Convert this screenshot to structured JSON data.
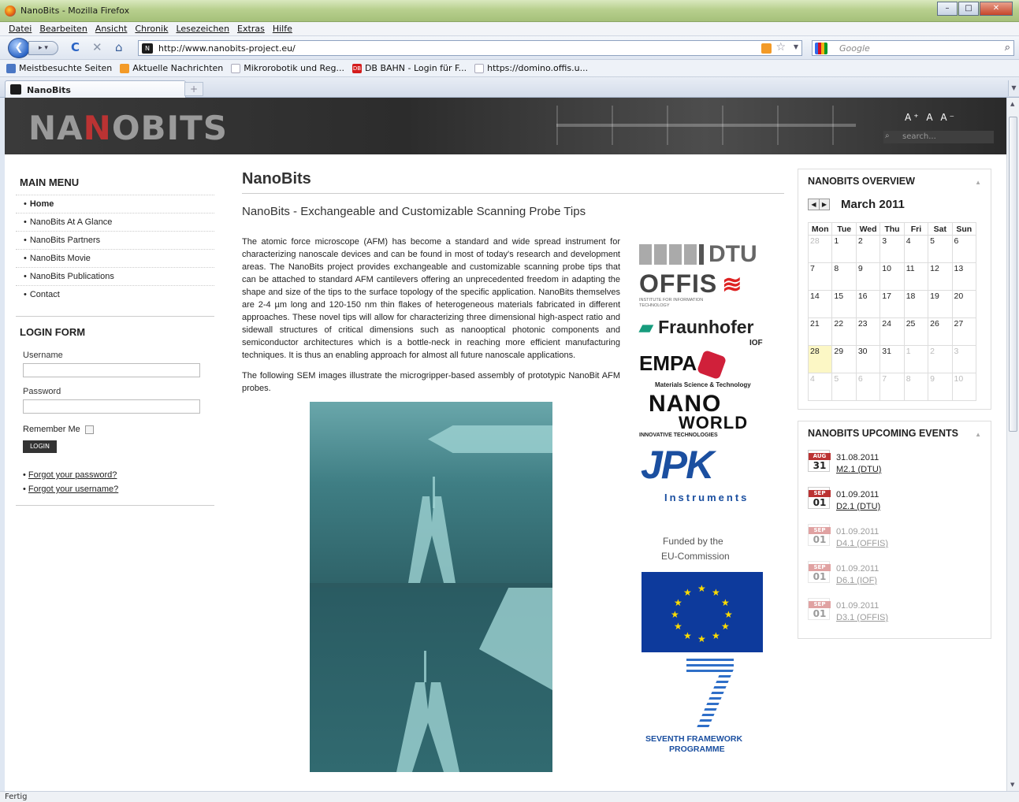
{
  "window": {
    "title": "NanoBits - Mozilla Firefox"
  },
  "menubar": [
    "Datei",
    "Bearbeiten",
    "Ansicht",
    "Chronik",
    "Lesezeichen",
    "Extras",
    "Hilfe"
  ],
  "nav": {
    "url": "http://www.nanobits-project.eu/",
    "search_placeholder": "Google"
  },
  "bookmarks": [
    {
      "label": "Meistbesuchte Seiten"
    },
    {
      "label": "Aktuelle Nachrichten"
    },
    {
      "label": "Mikrorobotik und Reg..."
    },
    {
      "label": "DB BAHN - Login für F..."
    },
    {
      "label": "https://domino.offis.u..."
    }
  ],
  "tab": {
    "label": "NanoBits",
    "new_tab": "+"
  },
  "header": {
    "logo_left": "NA",
    "logo_n": "N",
    "logo_right": "OBITS",
    "font_sizes": "A⁺ A A⁻",
    "search_placeholder": "search..."
  },
  "sidebar": {
    "main_menu_title": "MAIN MENU",
    "items": [
      {
        "label": "Home"
      },
      {
        "label": "NanoBits At A Glance"
      },
      {
        "label": "NanoBits Partners"
      },
      {
        "label": "NanoBits Movie"
      },
      {
        "label": "NanoBits Publications"
      },
      {
        "label": "Contact"
      }
    ],
    "login_title": "LOGIN FORM",
    "username_label": "Username",
    "password_label": "Password",
    "remember_label": "Remember Me",
    "login_button": "LOGIN",
    "forgot_password": "Forgot your password?",
    "forgot_username": "Forgot your username?"
  },
  "main": {
    "title": "NanoBits",
    "subtitle": "NanoBits - Exchangeable and Customizable Scanning Probe Tips",
    "paragraph1": "The atomic force microscope (AFM) has become a standard and wide spread instrument for characterizing nanoscale devices and can be found in most of today's research and development areas. The NanoBits project provides exchangeable and customizable scanning probe tips that can be attached to standard AFM cantilevers offering an unprecedented freedom in adapting the shape and size of the tips to the surface topology of the specific application. NanoBits themselves are 2-4 µm long and 120-150 nm thin flakes of heterogeneous materials fabricated in different approaches. These novel tips will allow for characterizing three dimensional high-aspect ratio and sidewall structures of critical dimensions such as nanooptical photonic components and semiconductor architectures which is a bottle-neck in reaching more efficient manufacturing techniques. It is thus an enabling approach for almost all future nanoscale applications.",
    "paragraph2": "The following SEM images illustrate the microgripper-based assembly of prototypic NanoBit AFM probes."
  },
  "partners": {
    "dtu": "DTU",
    "offis": "OFFIS",
    "offis_sub": "INSTITUTE FOR INFORMATION TECHNOLOGY",
    "fraunhofer": "Fraunhofer",
    "fraunhofer_sub": "IOF",
    "empa": "EMPA",
    "empa_sub": "Materials Science & Technology",
    "nano": "NANO",
    "world": "WORLD",
    "nanoworld_sub": "INNOVATIVE TECHNOLOGIES",
    "jpk": "JPK",
    "jpk_sub": "Instruments",
    "funded": "Funded by the",
    "funded2": "EU-Commission",
    "fp7": "SEVENTH FRAMEWORK",
    "fp7b": "PROGRAMME"
  },
  "overview": {
    "title": "NANOBITS OVERVIEW",
    "month": "March 2011",
    "days": [
      "Mon",
      "Tue",
      "Wed",
      "Thu",
      "Fri",
      "Sat",
      "Sun"
    ],
    "weeks": [
      [
        {
          "d": "28",
          "o": true
        },
        {
          "d": "1"
        },
        {
          "d": "2"
        },
        {
          "d": "3"
        },
        {
          "d": "4"
        },
        {
          "d": "5"
        },
        {
          "d": "6"
        }
      ],
      [
        {
          "d": "7"
        },
        {
          "d": "8"
        },
        {
          "d": "9"
        },
        {
          "d": "10"
        },
        {
          "d": "11"
        },
        {
          "d": "12"
        },
        {
          "d": "13"
        }
      ],
      [
        {
          "d": "14"
        },
        {
          "d": "15"
        },
        {
          "d": "16"
        },
        {
          "d": "17"
        },
        {
          "d": "18"
        },
        {
          "d": "19"
        },
        {
          "d": "20"
        }
      ],
      [
        {
          "d": "21"
        },
        {
          "d": "22"
        },
        {
          "d": "23"
        },
        {
          "d": "24"
        },
        {
          "d": "25"
        },
        {
          "d": "26"
        },
        {
          "d": "27"
        }
      ],
      [
        {
          "d": "28",
          "t": true
        },
        {
          "d": "29"
        },
        {
          "d": "30"
        },
        {
          "d": "31"
        },
        {
          "d": "1",
          "o": true
        },
        {
          "d": "2",
          "o": true
        },
        {
          "d": "3",
          "o": true
        }
      ],
      [
        {
          "d": "4",
          "o": true
        },
        {
          "d": "5",
          "o": true
        },
        {
          "d": "6",
          "o": true
        },
        {
          "d": "7",
          "o": true
        },
        {
          "d": "8",
          "o": true
        },
        {
          "d": "9",
          "o": true
        },
        {
          "d": "10",
          "o": true
        }
      ]
    ]
  },
  "events": {
    "title": "NANOBITS UPCOMING EVENTS",
    "items": [
      {
        "mo": "AUG",
        "dy": "31",
        "date": "31.08.2011",
        "name": "M2.1 (DTU)"
      },
      {
        "mo": "SEP",
        "dy": "01",
        "date": "01.09.2011",
        "name": "D2.1 (DTU)"
      },
      {
        "mo": "SEP",
        "dy": "01",
        "date": "01.09.2011",
        "name": "D4.1 (OFFIS)"
      },
      {
        "mo": "SEP",
        "dy": "01",
        "date": "01.09.2011",
        "name": "D6.1 (IOF)"
      },
      {
        "mo": "SEP",
        "dy": "01",
        "date": "01.09.2011",
        "name": "D3.1 (OFFIS)"
      }
    ]
  },
  "status": "Fertig"
}
